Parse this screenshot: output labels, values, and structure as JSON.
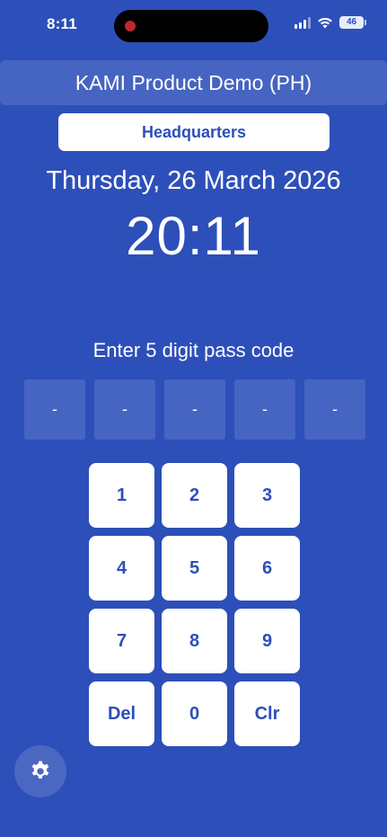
{
  "status_bar": {
    "time": "8:11",
    "battery": "46",
    "icons": [
      "recording-dot-icon",
      "cellular-signal-icon",
      "wifi-icon",
      "battery-icon"
    ]
  },
  "header": {
    "company": "KAMI Product Demo (PH)",
    "location": "Headquarters",
    "date": "Thursday, 26 March 2026",
    "time": "20:11"
  },
  "passcode": {
    "prompt": "Enter 5 digit pass code",
    "digits": [
      "-",
      "-",
      "-",
      "-",
      "-"
    ]
  },
  "keypad": {
    "keys": [
      "1",
      "2",
      "3",
      "4",
      "5",
      "6",
      "7",
      "8",
      "9",
      "Del",
      "0",
      "Clr"
    ]
  },
  "settings": {
    "icon": "gear-icon"
  },
  "colors": {
    "background": "#2d4fb9",
    "accent_text": "#2d4fb9",
    "key_background": "#ffffff",
    "recording_dot": "#c1272d"
  }
}
